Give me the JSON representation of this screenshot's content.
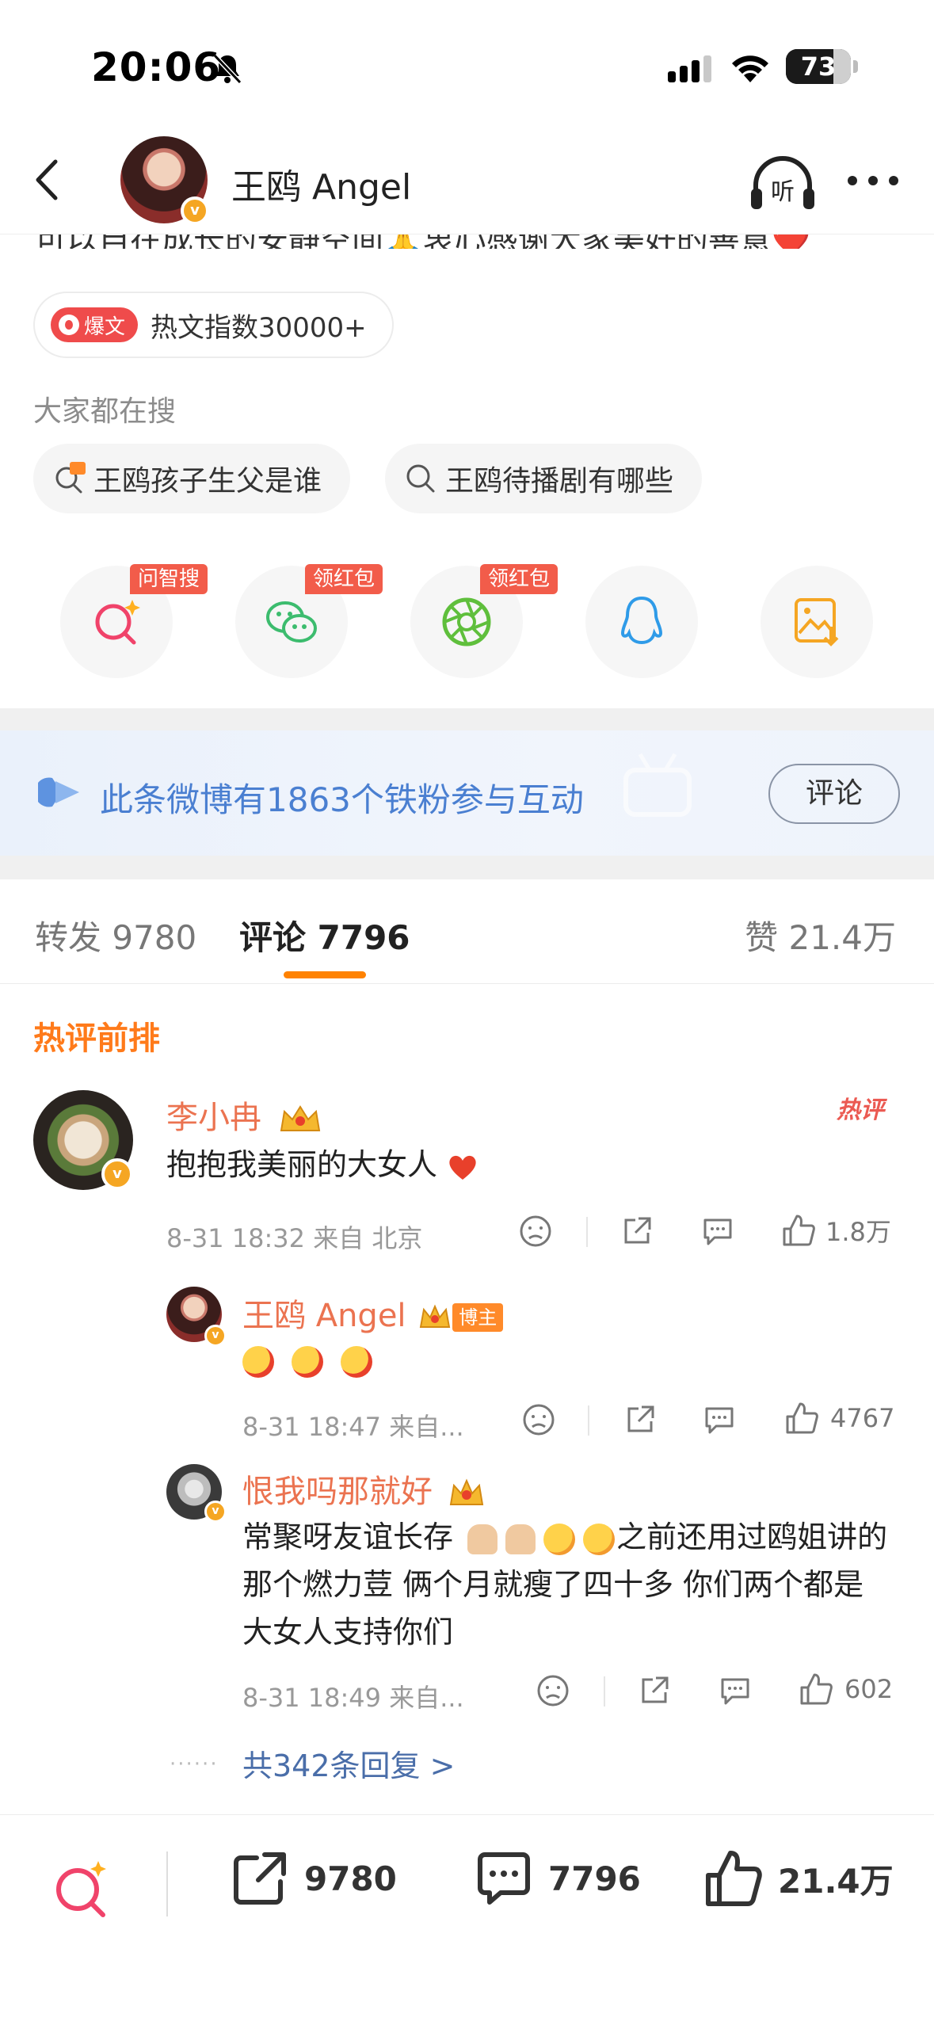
{
  "status_bar": {
    "time": "20:06",
    "battery": "73"
  },
  "header": {
    "title": "王鸥 Angel",
    "listen_label": "听"
  },
  "post": {
    "cut_text": "可以自在成长的安静空间🙏衷心感谢大家美好的善意❤️",
    "hot_badge": "爆文",
    "hot_index": "热文指数30000+"
  },
  "search": {
    "title": "大家都在搜",
    "items": [
      {
        "label": "王鸥孩子生父是谁",
        "icon": "hot-search-icon"
      },
      {
        "label": "王鸥待播剧有哪些",
        "icon": "search-icon"
      }
    ]
  },
  "share": {
    "items": [
      {
        "name": "ai-search-icon",
        "tag": "问智搜"
      },
      {
        "name": "wechat-icon",
        "tag": "领红包"
      },
      {
        "name": "moments-icon",
        "tag": "领红包"
      },
      {
        "name": "qq-icon",
        "tag": ""
      },
      {
        "name": "save-image-icon",
        "tag": ""
      }
    ]
  },
  "fans_banner": {
    "text": "此条微博有1863个铁粉参与互动",
    "button": "评论"
  },
  "tabs": {
    "repost": "转发 9780",
    "comment": "评论 7796",
    "like": "赞 21.4万"
  },
  "section_title": "热评前排",
  "comments": [
    {
      "name": "李小冉",
      "text": "抱抱我美丽的大女人",
      "hot_tag": "热评",
      "meta": "8-31 18:32  来自 北京",
      "likes": "1.8万"
    },
    {
      "name": "王鸥 Angel",
      "author_tag": "博主",
      "meta": "8-31 18:47  来自...",
      "likes": "4767"
    },
    {
      "name": "恨我吗那就好",
      "text_line1": "常聚呀友谊长存",
      "text_line1_tail": "之前还用过鸥姐讲的",
      "text_line2": "那个燃力荳 俩个月就瘦了四十多 你们两个都是",
      "text_line3": "大女人支持你们",
      "meta": "8-31 18:49  来自...",
      "likes": "602"
    }
  ],
  "replies_link": "共342条回复 >",
  "bottom_bar": {
    "repost": "9780",
    "comment": "7796",
    "like": "21.4万"
  },
  "colors": {
    "accent": "#ff8200",
    "name": "#eb7350",
    "link": "#4a6ea9",
    "banner_text": "#4a7fd1"
  }
}
